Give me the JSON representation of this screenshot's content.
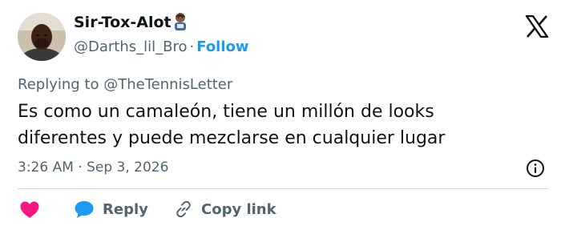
{
  "author": {
    "display_name": "Sir-Tox-Alot",
    "handle": "@Darths_lil_Bro",
    "separator": "·",
    "follow_label": "Follow",
    "avatar": "profile-photo",
    "badge_icon": "technologist-emoji"
  },
  "reply_context": {
    "prefix": "Replying to",
    "mention": "@TheTennisLetter"
  },
  "tweet": {
    "text_lines": [
      "Es como un camaleón, tiene un millón de looks",
      "diferentes y puede mezclarse en cualquier lugar"
    ],
    "timestamp": "3:26 AM · Sep 3, 2026"
  },
  "actions": {
    "reply_label": "Reply",
    "copy_link_label": "Copy link"
  },
  "icons": {
    "platform": "x-logo-icon",
    "info": "info-icon",
    "like": "heart-icon",
    "reply": "speech-bubble-icon",
    "copy": "link-icon"
  },
  "colors": {
    "accent": "#1d9bf0",
    "heart": "#f91880",
    "text": "#0f1419",
    "secondary": "#536471",
    "divider": "#cfd9de"
  }
}
